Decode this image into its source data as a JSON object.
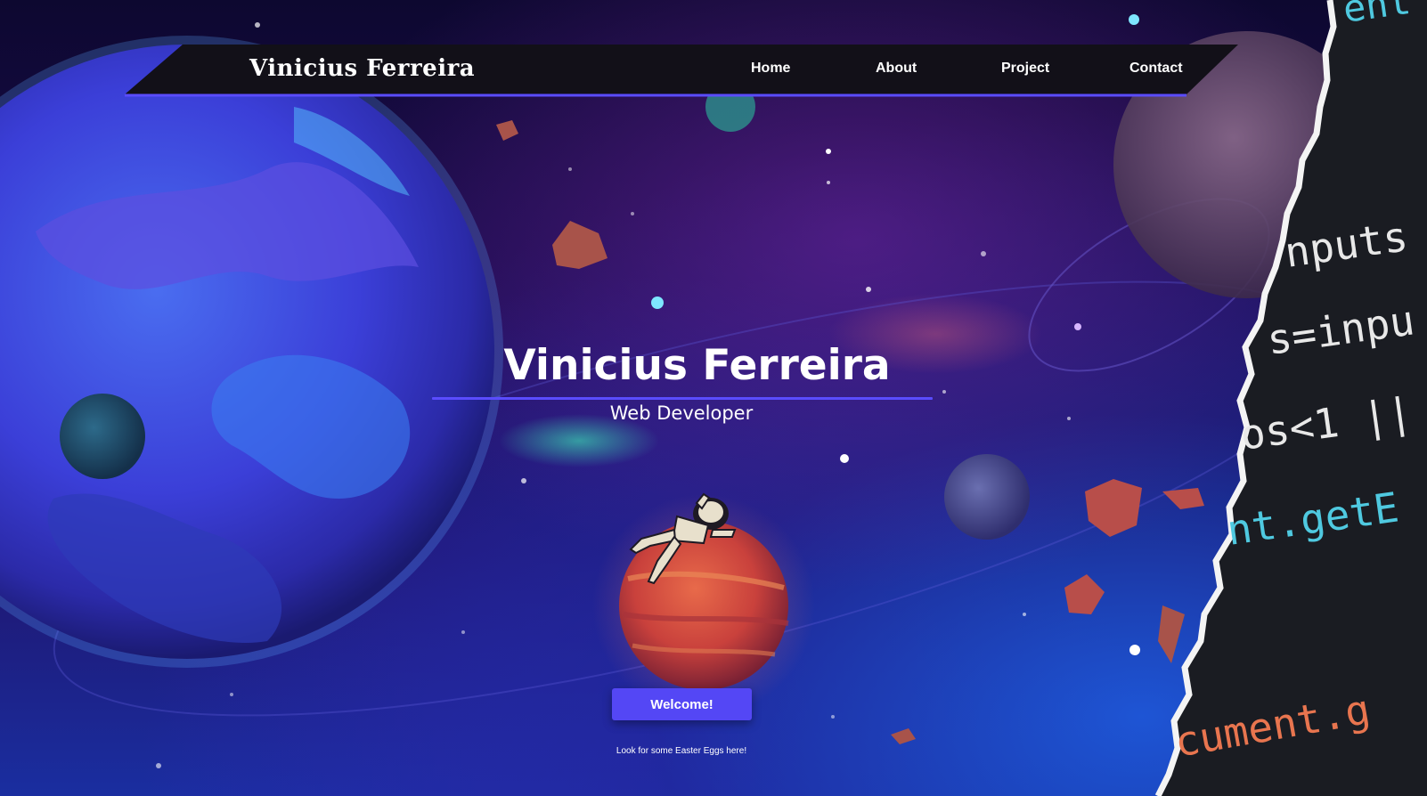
{
  "navbar": {
    "brand": "Vinicius Ferreira",
    "links": [
      {
        "label": "Home"
      },
      {
        "label": "About"
      },
      {
        "label": "Project"
      },
      {
        "label": "Contact"
      }
    ]
  },
  "hero": {
    "title": "Vinicius Ferreira",
    "subtitle": "Web Developer",
    "button_label": "Welcome!",
    "hint": "Look for some Easter Eggs here!"
  },
  "code_fragments": [
    {
      "text": "ent",
      "color": "#4fc9e0"
    },
    {
      "text": "nputs",
      "color": "#e8e8e8"
    },
    {
      "text": "s=inpu",
      "color": "#e8e8e8"
    },
    {
      "text": "os<1 ||",
      "color": "#e8e8e8"
    },
    {
      "text": "nt.getE",
      "color": "#4fc9e0"
    },
    {
      "text": "cument.g",
      "color": "#e8754f"
    }
  ],
  "colors": {
    "accent": "#5447f5",
    "navbar": "#121018",
    "navbar_underline": "#5a4cff",
    "code_bg": "#1a1c22"
  },
  "icons": {
    "astronaut": "astronaut-illustration",
    "planets": "planet-illustrations"
  }
}
